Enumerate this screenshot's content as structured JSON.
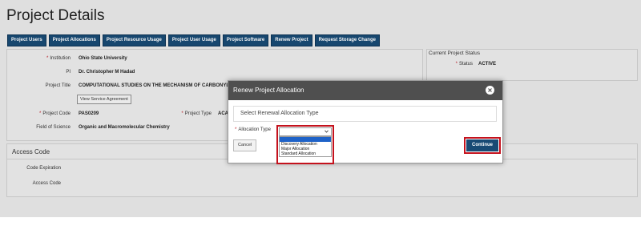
{
  "page_title": "Project Details",
  "tabs": [
    "Project Users",
    "Project Allocations",
    "Project Resource Usage",
    "Project User Usage",
    "Project Software",
    "Renew Project",
    "Request Storage Change"
  ],
  "details": {
    "institution_label": "Institution",
    "institution_value": "Ohio State University",
    "pi_label": "PI",
    "pi_value": "Dr. Christopher M Hadad",
    "title_label": "Project Title",
    "title_value": "COMPUTATIONAL STUDIES ON THE MECHANISM OF CARBONYL AUT",
    "view_agreement_label": "View Service Agreement",
    "code_label": "Project Code",
    "code_value": "PAS0209",
    "type_label": "Project Type",
    "type_value": "ACA",
    "field_label": "Field of Science",
    "field_value": "Organic and Macromolecular Chemistry"
  },
  "status_panel": {
    "title": "Current Project Status",
    "status_label": "Status",
    "status_value": "ACTIVE"
  },
  "access_code": {
    "title": "Access Code",
    "expiration_label": "Code Expiration",
    "code_label": "Access Code"
  },
  "modal": {
    "title": "Renew Project Allocation",
    "section_label": "Select Renewal Allocation Type",
    "field_label": "Allocation Type",
    "selected_value": "",
    "options": [
      "",
      "Discovery Allocation",
      "Major Allocation",
      "Standard Allocation"
    ],
    "cancel_label": "Cancel",
    "continue_label": "Continue"
  },
  "colors": {
    "tab_bg": "#184a74",
    "modal_header": "#4f4f4f",
    "highlight_border": "#c4121d",
    "required": "#c0202a",
    "selected_option": "#1e62c8"
  },
  "icons": {
    "close": "close-icon",
    "dropdown": "chevron-down-icon"
  }
}
